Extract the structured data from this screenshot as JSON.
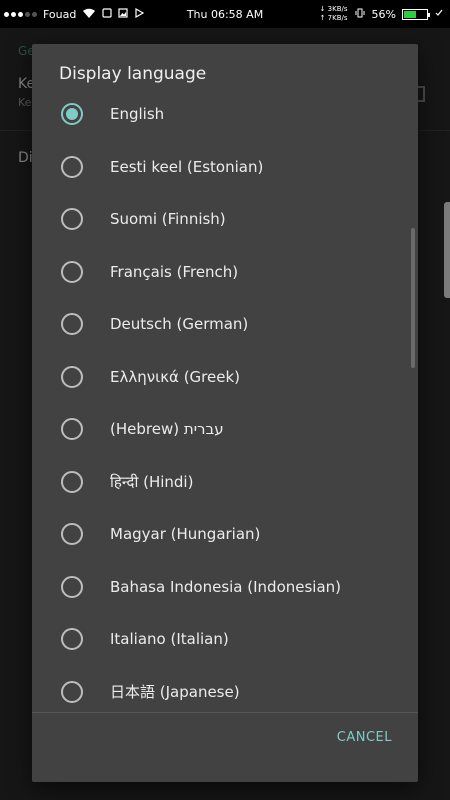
{
  "status_bar": {
    "carrier": "Fouad",
    "time": "Thu 06:58 AM",
    "net_down": "↓ 3KB/s",
    "net_up": "↑ 7KB/s",
    "battery_percent": "56%",
    "battery_level": 0.56,
    "icons": [
      "signal-dots",
      "wifi-icon",
      "notification-icon",
      "image-icon",
      "play-store-icon",
      "vibrate-icon",
      "battery-icon",
      "check-icon"
    ]
  },
  "background": {
    "section_header": "Ge",
    "row1_title": "Ke",
    "row1_subtitle": "Ke",
    "row2_title": "Di"
  },
  "dialog": {
    "title": "Display language",
    "selected_index": 0,
    "languages": [
      {
        "label": "English"
      },
      {
        "label": "Eesti keel (Estonian)"
      },
      {
        "label": "Suomi (Finnish)"
      },
      {
        "label": "Français (French)"
      },
      {
        "label": "Deutsch (German)"
      },
      {
        "label": "Ελληνικά (Greek)"
      },
      {
        "label": "(Hebrew) עברית"
      },
      {
        "label": "हिन्दी (Hindi)"
      },
      {
        "label": "Magyar (Hungarian)"
      },
      {
        "label": "Bahasa Indonesia (Indonesian)"
      },
      {
        "label": "Italiano (Italian)"
      },
      {
        "label": "日本語 (Japanese)"
      }
    ],
    "cancel_label": "CANCEL",
    "accent_color": "#80cbc4"
  }
}
